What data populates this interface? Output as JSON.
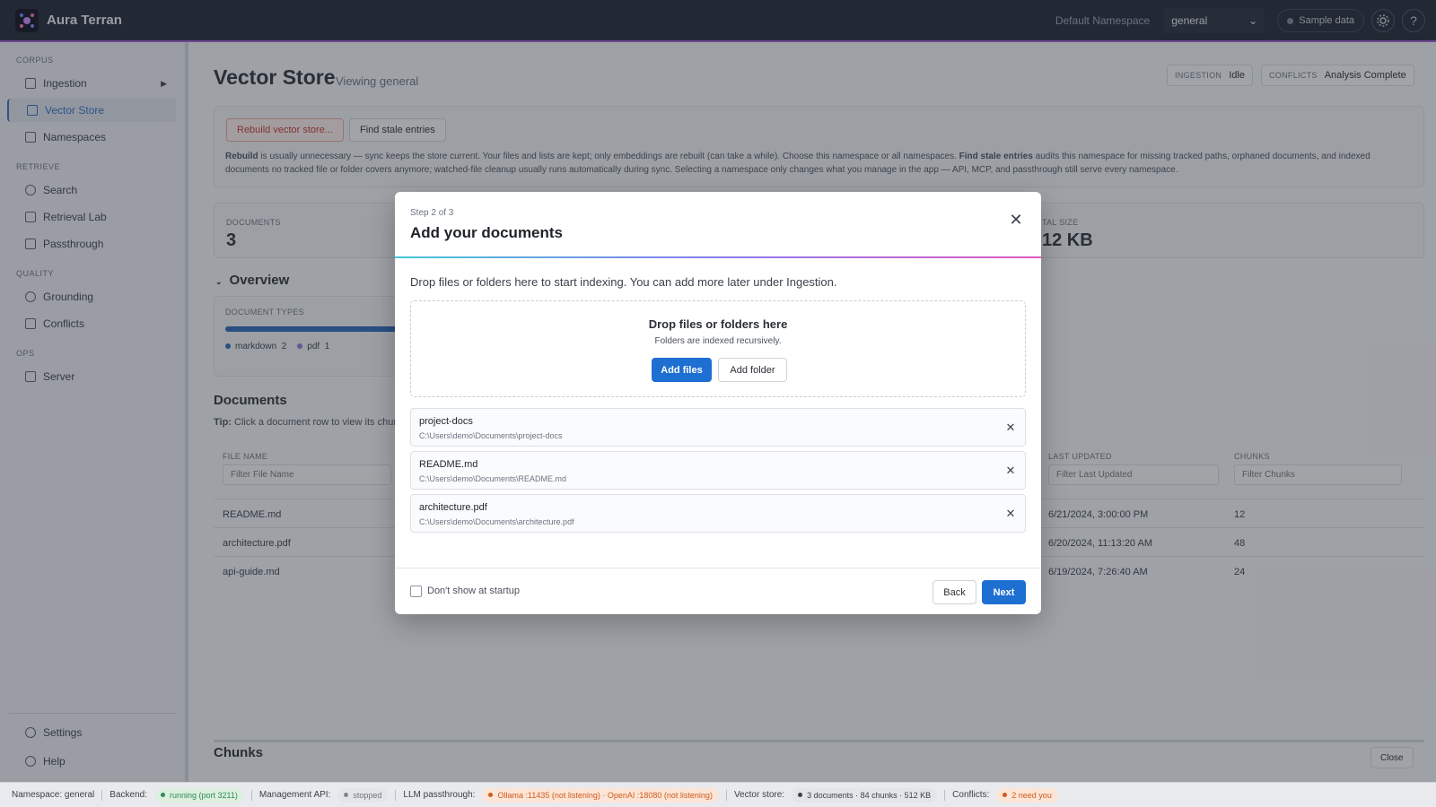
{
  "app": {
    "title": "Aura Terran"
  },
  "topbar": {
    "namespace_label": "Default Namespace",
    "namespace_value": "general",
    "sample_data_label": "Sample data",
    "settings_icon": "gear-icon",
    "help_label": "?"
  },
  "sidebar": {
    "sections": {
      "corpus": "CORPUS",
      "retrieve": "RETRIEVE",
      "quality": "QUALITY",
      "ops": "OPS"
    },
    "items": {
      "ingestion": "Ingestion",
      "vector_store": "Vector Store",
      "namespaces": "Namespaces",
      "search": "Search",
      "retrieval_lab": "Retrieval Lab",
      "passthrough": "Passthrough",
      "grounding": "Grounding",
      "conflicts": "Conflicts",
      "server": "Server",
      "settings": "Settings",
      "help": "Help"
    },
    "active": "Vector Store"
  },
  "page": {
    "title": "Vector Store",
    "subtitle": "Viewing general",
    "ingestion_key": "INGESTION",
    "ingestion_value": "Idle",
    "conflicts_key": "CONFLICTS",
    "conflicts_value": "Analysis Complete",
    "rebuild_button": "Rebuild vector store...",
    "find_stale_button": "Find stale entries",
    "help_text": {
      "rebuild_word": "Rebuild",
      "part1": " is usually unnecessary — sync keeps the store current. Your files and lists are kept; only embeddings are rebuilt (can take a while). Choose this namespace or all namespaces. ",
      "find_word": "Find stale entries",
      "part2": " audits this namespace for missing tracked paths, orphaned documents, and indexed documents no tracked file or folder covers anymore; watched-file cleanup usually runs automatically during sync. Selecting a namespace only changes what you manage in the app — API, MCP, and passthrough still serve every namespace."
    },
    "stats": {
      "documents_key": "DOCUMENTS",
      "documents_value": "3",
      "total_size_key": "TAL SIZE",
      "total_size_value": "12 KB"
    },
    "overview_title": "Overview",
    "document_types_key": "DOCUMENT TYPES",
    "document_types": [
      {
        "label": "markdown",
        "count": "2",
        "color": "#2a66b5"
      },
      {
        "label": "pdf",
        "count": "1",
        "color": "#8a7cd6"
      }
    ],
    "documents_title": "Documents",
    "tip_bold": "Tip:",
    "tip_text": " Click a document row to view its chun",
    "columns": {
      "file_name": "FILE NAME",
      "last_updated": "LAST UPDATED",
      "chunks": "CHUNKS"
    },
    "filters": {
      "file_name": "Filter File Name",
      "last_updated": "Filter Last Updated",
      "chunks": "Filter Chunks"
    },
    "rows": [
      {
        "name": "README.md",
        "updated": "6/21/2024, 3:00:00 PM",
        "chunks": "12"
      },
      {
        "name": "architecture.pdf",
        "updated": "6/20/2024, 11:13:20 AM",
        "chunks": "48"
      },
      {
        "name": "api-guide.md",
        "updated": "6/19/2024, 7:26:40 AM",
        "chunks": "24"
      }
    ],
    "chunks_title": "Chunks",
    "close_button": "Close"
  },
  "modal": {
    "step": "Step 2 of 3",
    "title": "Add your documents",
    "lead": "Drop files or folders here to start indexing. You can add more later under Ingestion.",
    "dropzone_title": "Drop files or folders here",
    "dropzone_sub": "Folders are indexed recursively.",
    "add_files": "Add files",
    "add_folder": "Add folder",
    "files": [
      {
        "name": "project-docs",
        "path": "C:\\Users\\demo\\Documents\\project-docs"
      },
      {
        "name": "README.md",
        "path": "C:\\Users\\demo\\Documents\\README.md"
      },
      {
        "name": "architecture.pdf",
        "path": "C:\\Users\\demo\\Documents\\architecture.pdf"
      }
    ],
    "dont_show": "Don't show at startup",
    "back": "Back",
    "next": "Next",
    "close_glyph": "✕",
    "remove_glyph": "✕"
  },
  "statusbar": {
    "namespace": "Namespace: general",
    "backend_label": "Backend:",
    "backend_value": "running (port 3211)",
    "mgmt_label": "Management API:",
    "mgmt_value": "stopped",
    "llm_label": "LLM passthrough:",
    "llm_value": "Ollama :11435 (not listening) · OpenAI :18080 (not listening)",
    "vector_label": "Vector store:",
    "vector_value": "3 documents · 84 chunks · 512 KB",
    "conflicts_label": "Conflicts:",
    "conflicts_value": "2 need you"
  },
  "colors": {
    "accent": "#1d6fd1",
    "topbar": "#1f2633",
    "danger": "#c0392b",
    "ok": "#2e8b57",
    "warn": "#d05a1e"
  }
}
